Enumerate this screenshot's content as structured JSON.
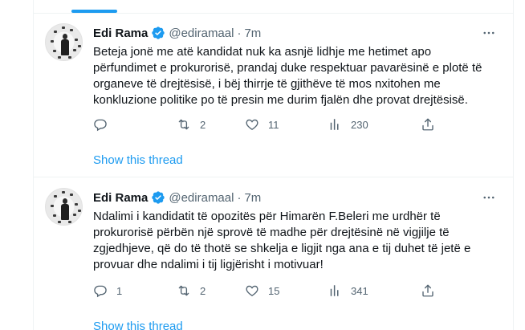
{
  "colors": {
    "accent": "#1d9bf0",
    "text": "#0f1419",
    "muted": "#536471",
    "divider": "#eff3f4"
  },
  "tweets": [
    {
      "author": {
        "name": "Edi Rama",
        "handle": "@ediramaal",
        "separator": "·",
        "time": "7m",
        "verified_icon": "verified-badge-icon",
        "avatar_icon": "avatar"
      },
      "text": "Beteja jonë me atë kandidat nuk ka asnjë lidhje me hetimet apo\npërfundimet e prokurorisë, prandaj duke respektuar pavarësinë e plotë të\norganeve të drejtësisë, i bëj thirrje të gjithëve të mos nxitohen me\nkonkluzione politike po të presin me durim fjalën dhe provat drejtësisë.",
      "actions": {
        "replies": "",
        "retweets": "2",
        "likes": "11",
        "views": "230"
      },
      "show_thread": "Show this thread"
    },
    {
      "author": {
        "name": "Edi Rama",
        "handle": "@ediramaal",
        "separator": "·",
        "time": "7m",
        "verified_icon": "verified-badge-icon",
        "avatar_icon": "avatar"
      },
      "text": "Ndalimi i kandidatit të opozitës për Himarën F.Beleri me urdhër të\nprokurorisë përbën një sprovë të madhe për drejtësinë në vigjilje të\nzgjedhjeve, që do të thotë se shkelja e ligjit nga ana e tij duhet të jetë e\nprovuar dhe ndalimi i tij ligjërisht i motivuar!",
      "actions": {
        "replies": "1",
        "retweets": "2",
        "likes": "15",
        "views": "341"
      },
      "show_thread": "Show this thread"
    }
  ]
}
